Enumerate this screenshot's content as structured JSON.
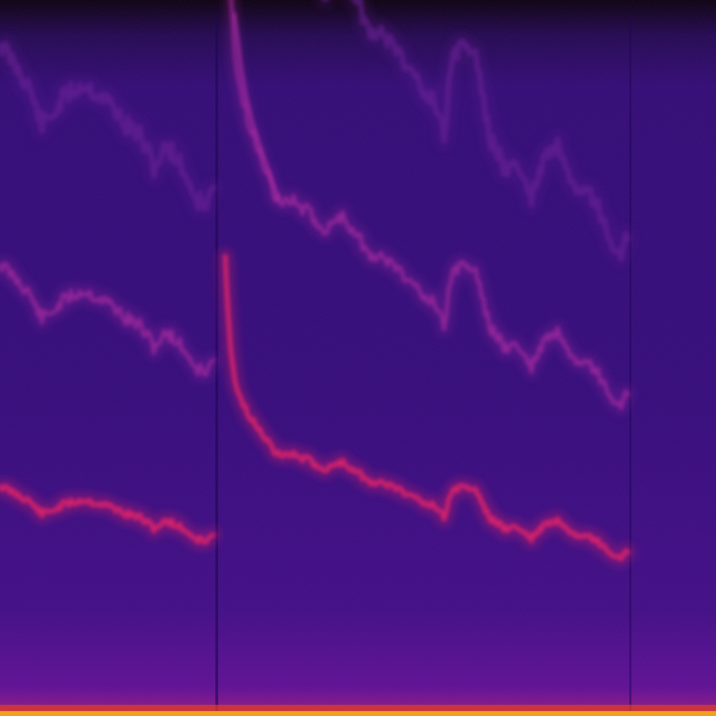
{
  "image": {
    "kind": "spectrogram",
    "colormap": "plasma-like",
    "colors": {
      "background_top": "#000000",
      "background_mid": "#2a0a6e",
      "background_low": "#4a0f8a",
      "harmonic_strong": "#d8246a",
      "harmonic_mid": "#a82aa0",
      "harmonic_weak": "#6e2298",
      "bottom_band": "#f0a020",
      "bottom_band_edge": "#e0401a"
    }
  }
}
